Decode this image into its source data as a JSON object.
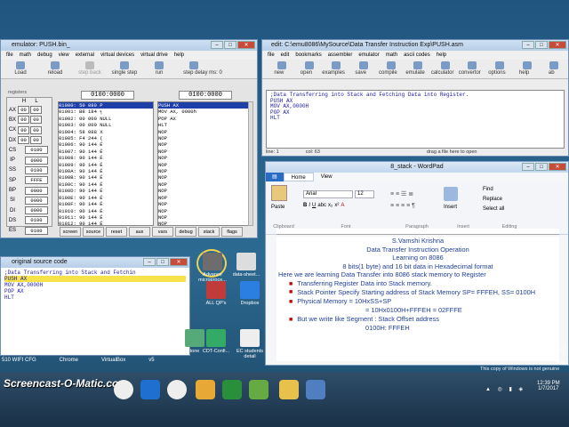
{
  "emulator": {
    "title": "emulator: PUSH.bin_",
    "menu": [
      "file",
      "math",
      "debug",
      "view",
      "external",
      "virtual devices",
      "virtual drive",
      "help"
    ],
    "toolbar": [
      "Load",
      "reload",
      "step back",
      "single step",
      "run",
      "step delay ms: 0"
    ],
    "addr1": "0100:0000",
    "addr2": "0100:0000",
    "regs_label": "registers",
    "hl": [
      "H",
      "L"
    ],
    "regs": [
      [
        "AX",
        "00",
        "00"
      ],
      [
        "BX",
        "00",
        "00"
      ],
      [
        "CX",
        "00",
        "00"
      ],
      [
        "DX",
        "00",
        "00"
      ]
    ],
    "segs": [
      [
        "CS",
        "0100"
      ],
      [
        "IP",
        "0000"
      ],
      [
        "SS",
        "0100"
      ],
      [
        "SP",
        "FFFE"
      ],
      [
        "BP",
        "0000"
      ],
      [
        "SI",
        "0000"
      ],
      [
        "DI",
        "0000"
      ],
      [
        "DS",
        "0100"
      ],
      [
        "ES",
        "0100"
      ]
    ],
    "mem": [
      "01000: 50 080 P",
      "01001: B8 184 ╕",
      "01002: 00 000 NULL",
      "01003: 00 000 NULL",
      "01004: 58 088 X",
      "01005: F4 244 (",
      "01006: 90 144 É",
      "01007: 90 144 É",
      "01008: 90 144 É",
      "01009: 90 144 É",
      "0100A: 90 144 É",
      "0100B: 90 144 É",
      "0100C: 90 144 É",
      "0100D: 90 144 É",
      "0100E: 90 144 É",
      "0100F: 90 144 É",
      "01010: 90 144 É",
      "01011: 90 144 É",
      "01012: 90 144 É",
      "01013: 90 144 É",
      "01014: 90 144 É",
      "01015: 90 144 É"
    ],
    "dis": [
      "PUSH AX",
      "MOV AX, 0000h",
      "POP AX",
      "HLT",
      "NOP",
      "NOP",
      "NOP",
      "NOP",
      "NOP",
      "NOP",
      "NOP",
      "NOP",
      "NOP",
      "NOP",
      "NOP",
      "NOP",
      "NOP",
      "NOP",
      "NOP",
      "NOP",
      "NOP",
      "NOP"
    ],
    "bottom": [
      "screen",
      "source",
      "reset",
      "aux",
      "vars",
      "debug",
      "stack",
      "flags"
    ]
  },
  "editor": {
    "title": "edit: C:\\emu8086\\MySource\\Data Transfer Instruction Exp\\PUSH.asm",
    "menu": [
      "file",
      "edit",
      "bookmarks",
      "assembler",
      "emulator",
      "math",
      "ascii codes",
      "help"
    ],
    "toolbar": [
      "new",
      "open",
      "examples",
      "save",
      "compile",
      "emulate",
      "calculator",
      "convertor",
      "options",
      "help",
      "ab"
    ],
    "code": [
      ";Data Transferring into Stack and Fetching Data into Register.",
      "",
      "PUSH AX",
      "MOV AX,0000H",
      "POP AX",
      "HLT"
    ],
    "status_line": "line: 1",
    "status_col": "col: 63",
    "status_hint": "drag a file here to open"
  },
  "wordpad": {
    "title": "8_stack - WordPad",
    "tabs": [
      "Home",
      "View"
    ],
    "font": "Arial",
    "size": "12",
    "groups": [
      "Clipboard",
      "Font",
      "Paragraph",
      "Insert",
      "Editing"
    ],
    "paste": "Paste",
    "insert": "Insert",
    "edit_items": [
      "Find",
      "Replace",
      "Select all"
    ],
    "lines": [
      "S.Vamshi Krishna",
      "Data Transfer Instruction Operation",
      "Learning on 8086",
      "8 bits(1 byte) and 16 bit data in Hexadecimal format",
      "Here we are learning Data Transfer into 8086 stack memory  to Register"
    ],
    "bullets": [
      "Transferring Register Data into Stack memory.",
      "Stack Pointer Specify Starting address of Stack Memory  SP= FFFEH, SS= 0100H",
      "Physical  Memory = 10HxSS+SP",
      "= 10Hx0100H+FFFEH = 02FFFE",
      "But we write like Segment : Stack Offset address",
      "0100H: FFFEH"
    ]
  },
  "small_editor": {
    "title": "original source code",
    "code": [
      ";Data Transferring into Stack and Fetchin",
      "PUSH AX",
      "MOV AX,0000H",
      "POP AX",
      "HLT"
    ]
  },
  "desktop": {
    "icons": [
      "ALL QP's",
      "Dropbox",
      "Advance microproce...",
      "data-sheet...",
      "tone",
      "CDT-Confi...",
      "EC students detail"
    ]
  },
  "taskbar": {
    "left": [
      "510 WIFI CFG",
      "Chrome",
      "VirtualBox",
      "v5"
    ],
    "watermark": "Screencast-O-Matic.com",
    "genuine": "This copy of Windows is not genuine",
    "build": "ows 7",
    "build2": "d 7601",
    "time": "12:39 PM",
    "date": "1/7/2017"
  }
}
